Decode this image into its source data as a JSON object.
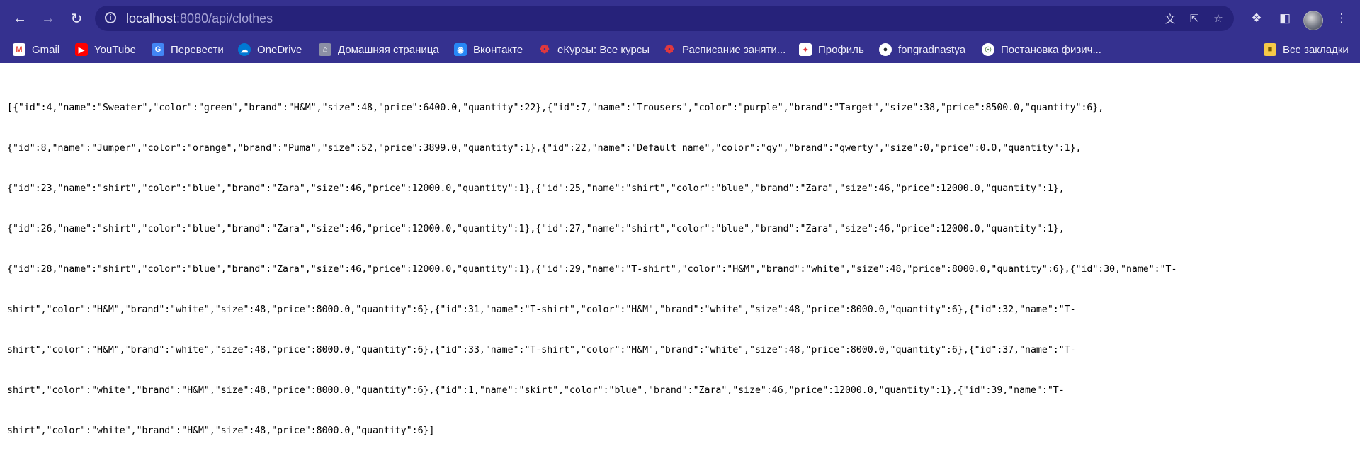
{
  "browser": {
    "url_host": "localhost",
    "url_path": ":8080/api/clothes",
    "nav": {
      "back_icon": "back-arrow-icon",
      "forward_icon": "forward-arrow-icon",
      "reload_icon": "reload-icon"
    },
    "bookmarks": [
      {
        "label": "Gmail",
        "icon": "gmail-icon",
        "color": "#ea4335"
      },
      {
        "label": "YouTube",
        "icon": "youtube-icon",
        "color": "#ff0000"
      },
      {
        "label": "Перевести",
        "icon": "translate-icon",
        "color": "#4285f4"
      },
      {
        "label": "OneDrive",
        "icon": "onedrive-icon",
        "color": "#0078d4"
      },
      {
        "label": "Домашняя страница",
        "icon": "home-page-icon",
        "color": "#8b8fa5"
      },
      {
        "label": "Вконтакте",
        "icon": "vk-icon",
        "color": "#2787f5"
      },
      {
        "label": "еКурсы: Все курсы",
        "icon": "ekursy-icon",
        "color": "#e0383e"
      },
      {
        "label": "Расписание заняти...",
        "icon": "schedule-icon",
        "color": "#e0383e"
      },
      {
        "label": "Профиль",
        "icon": "profile-icon",
        "color": "#e0383e"
      },
      {
        "label": "fongradnastya",
        "icon": "github-icon",
        "color": "#24292e"
      },
      {
        "label": "Постановка физич...",
        "icon": "site-icon",
        "color": "#5c8a54"
      }
    ],
    "all_bookmarks_label": "Все закладки"
  },
  "page": {
    "lines": [
      "[{\"id\":4,\"name\":\"Sweater\",\"color\":\"green\",\"brand\":\"H&M\",\"size\":48,\"price\":6400.0,\"quantity\":22},{\"id\":7,\"name\":\"Trousers\",\"color\":\"purple\",\"brand\":\"Target\",\"size\":38,\"price\":8500.0,\"quantity\":6},",
      "{\"id\":8,\"name\":\"Jumper\",\"color\":\"orange\",\"brand\":\"Puma\",\"size\":52,\"price\":3899.0,\"quantity\":1},{\"id\":22,\"name\":\"Default name\",\"color\":\"qy\",\"brand\":\"qwerty\",\"size\":0,\"price\":0.0,\"quantity\":1},",
      "{\"id\":23,\"name\":\"shirt\",\"color\":\"blue\",\"brand\":\"Zara\",\"size\":46,\"price\":12000.0,\"quantity\":1},{\"id\":25,\"name\":\"shirt\",\"color\":\"blue\",\"brand\":\"Zara\",\"size\":46,\"price\":12000.0,\"quantity\":1},",
      "{\"id\":26,\"name\":\"shirt\",\"color\":\"blue\",\"brand\":\"Zara\",\"size\":46,\"price\":12000.0,\"quantity\":1},{\"id\":27,\"name\":\"shirt\",\"color\":\"blue\",\"brand\":\"Zara\",\"size\":46,\"price\":12000.0,\"quantity\":1},",
      "{\"id\":28,\"name\":\"shirt\",\"color\":\"blue\",\"brand\":\"Zara\",\"size\":46,\"price\":12000.0,\"quantity\":1},{\"id\":29,\"name\":\"T-shirt\",\"color\":\"H&M\",\"brand\":\"white\",\"size\":48,\"price\":8000.0,\"quantity\":6},{\"id\":30,\"name\":\"T-",
      "shirt\",\"color\":\"H&M\",\"brand\":\"white\",\"size\":48,\"price\":8000.0,\"quantity\":6},{\"id\":31,\"name\":\"T-shirt\",\"color\":\"H&M\",\"brand\":\"white\",\"size\":48,\"price\":8000.0,\"quantity\":6},{\"id\":32,\"name\":\"T-",
      "shirt\",\"color\":\"H&M\",\"brand\":\"white\",\"size\":48,\"price\":8000.0,\"quantity\":6},{\"id\":33,\"name\":\"T-shirt\",\"color\":\"H&M\",\"brand\":\"white\",\"size\":48,\"price\":8000.0,\"quantity\":6},{\"id\":37,\"name\":\"T-",
      "shirt\",\"color\":\"white\",\"brand\":\"H&M\",\"size\":48,\"price\":8000.0,\"quantity\":6},{\"id\":1,\"name\":\"skirt\",\"color\":\"blue\",\"brand\":\"Zara\",\"size\":46,\"price\":12000.0,\"quantity\":1},{\"id\":39,\"name\":\"T-",
      "shirt\",\"color\":\"white\",\"brand\":\"H&M\",\"size\":48,\"price\":8000.0,\"quantity\":6}]"
    ]
  }
}
